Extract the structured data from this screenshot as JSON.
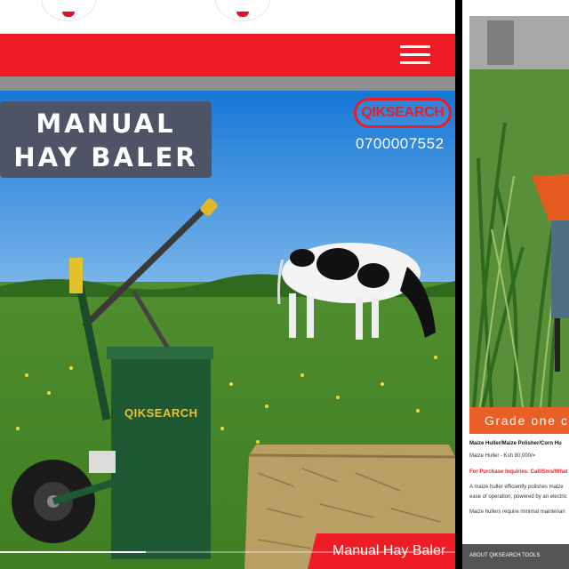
{
  "left_panel": {
    "menu_icon": "hamburger-menu-icon",
    "banner": {
      "title_lines": [
        "MANUAL",
        "HAY BALER"
      ],
      "logo_text": "QIKSEARCH",
      "phone": "0700007552",
      "machine_label": "QIKSEARCH",
      "ribbon_label": "Manual Hay Baler"
    },
    "slideshow_progress": 0.32
  },
  "right_panel": {
    "grade_label": "Grade one c",
    "product_title": "Maize Huller/Maize Polisher/Corn Hu",
    "price": "Maize Huller - Ksh 80,000/=",
    "inquiries": "For Purchase Inquiries: Call/Sms/What",
    "description_1": "A maize huller efficiently polishes maize",
    "description_2": "ease of operation, powered by an electric",
    "description_3": "Maize hullers require minimal maintenan",
    "footer": "ABOUT QIKSEARCH TOOLS"
  },
  "colors": {
    "brand_red": "#ee1c25",
    "grade_orange": "#ea5f27",
    "title_box": "#4e5366"
  }
}
